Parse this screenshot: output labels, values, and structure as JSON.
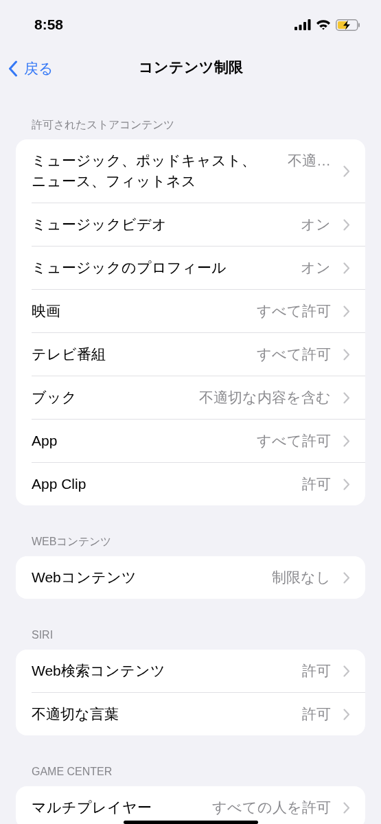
{
  "status_bar": {
    "time": "8:58"
  },
  "nav": {
    "back": "戻る",
    "title": "コンテンツ制限"
  },
  "sections": [
    {
      "header": "許可されたストアコンテンツ",
      "rows": [
        {
          "label": "ミュージック、ポッドキャスト、ニュース、フィットネス",
          "value": "不適…"
        },
        {
          "label": "ミュージックビデオ",
          "value": "オン"
        },
        {
          "label": "ミュージックのプロフィール",
          "value": "オン"
        },
        {
          "label": "映画",
          "value": "すべて許可"
        },
        {
          "label": "テレビ番組",
          "value": "すべて許可"
        },
        {
          "label": "ブック",
          "value": "不適切な内容を含む"
        },
        {
          "label": "App",
          "value": "すべて許可"
        },
        {
          "label": "App Clip",
          "value": "許可"
        }
      ]
    },
    {
      "header": "WEBコンテンツ",
      "rows": [
        {
          "label": "Webコンテンツ",
          "value": "制限なし"
        }
      ]
    },
    {
      "header": "SIRI",
      "rows": [
        {
          "label": "Web検索コンテンツ",
          "value": "許可"
        },
        {
          "label": "不適切な言葉",
          "value": "許可"
        }
      ]
    },
    {
      "header": "GAME CENTER",
      "rows": [
        {
          "label": "マルチプレイヤー",
          "value": "すべての人を許可"
        }
      ]
    }
  ]
}
